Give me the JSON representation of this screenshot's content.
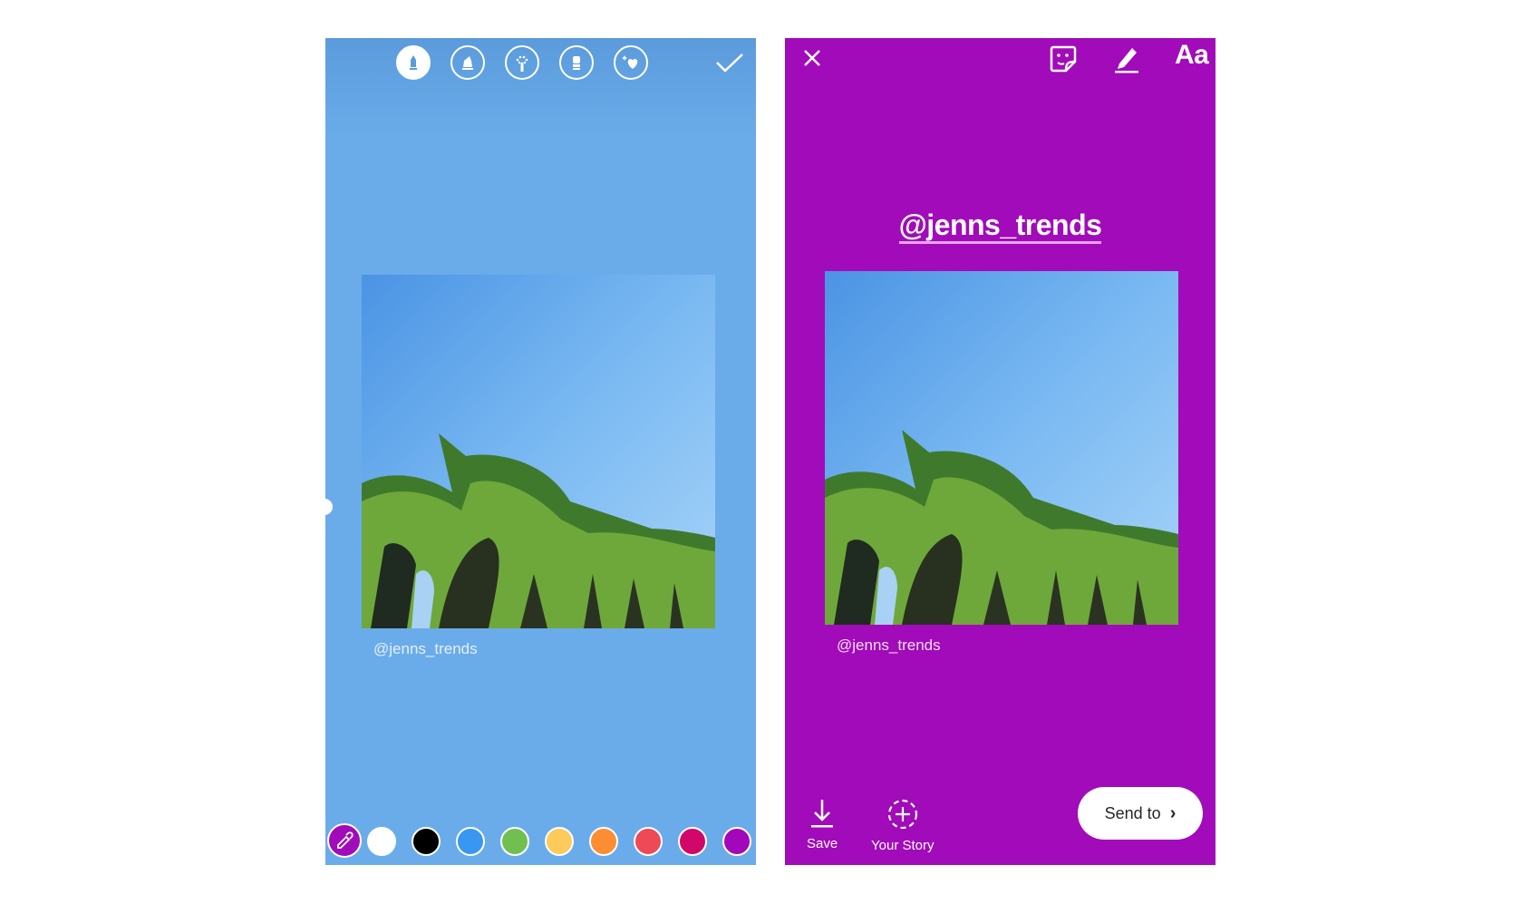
{
  "left_screen": {
    "name": "brush editor",
    "toolbar": {
      "tools": [
        {
          "icon": "marker-pen-icon",
          "label": "Pen",
          "selected": true
        },
        {
          "icon": "highlighter-icon",
          "label": "Highlighter",
          "selected": false
        },
        {
          "icon": "sparkle-brush-icon",
          "label": "Neon",
          "selected": false
        },
        {
          "icon": "eraser-icon",
          "label": "Eraser",
          "selected": false
        },
        {
          "icon": "heart-brush-icon",
          "label": "Sticker brush",
          "selected": false
        }
      ],
      "done_icon": "checkmark-icon"
    },
    "photo_caption": "@jenns_trends",
    "background_color": "#6aacea",
    "color_palette": {
      "eyedropper_icon": "eyedropper-icon",
      "colors": [
        "#ffffff",
        "#000000",
        "#3897f0",
        "#70c050",
        "#fdcb5c",
        "#fd8d32",
        "#ed4956",
        "#d10869",
        "#a307ba"
      ]
    }
  },
  "right_screen": {
    "name": "story share",
    "header": {
      "close_icon": "close-icon",
      "sticker_icon": "sticker-icon",
      "draw_icon": "draw-icon",
      "text_tool_label": "Aa"
    },
    "mention_sticker": "@jenns_trends",
    "photo_caption": "@jenns_trends",
    "background_color": "#a10bb9",
    "footer": {
      "save_label": "Save",
      "your_story_label": "Your Story",
      "send_to_label": "Send to",
      "send_chevron": "›"
    }
  }
}
